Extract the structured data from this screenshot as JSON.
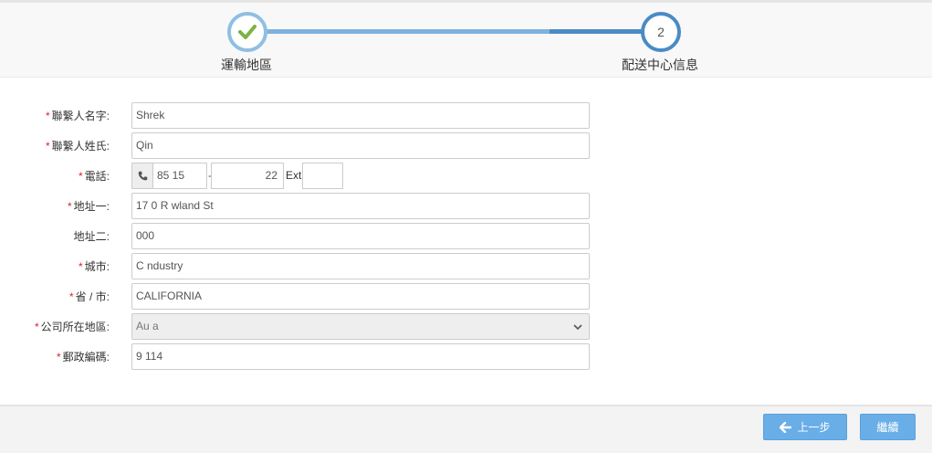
{
  "stepper": {
    "steps": [
      {
        "label": "運輸地區",
        "state": "done"
      },
      {
        "label": "配送中心信息",
        "number": "2",
        "state": "current"
      }
    ]
  },
  "form": {
    "first_name": {
      "label": "聯繫人名字:",
      "value": "Shrek",
      "required": true
    },
    "last_name": {
      "label": "聯繫人姓氏:",
      "value": "Qin",
      "required": true
    },
    "phone": {
      "label": "電話:",
      "area": "85  15",
      "number": "22",
      "ext_label": "Ext",
      "ext": "",
      "required": true
    },
    "address1": {
      "label": "地址一:",
      "value": "17  0 R wland St",
      "required": true
    },
    "address2": {
      "label": "地址二:",
      "value": "000",
      "required": false
    },
    "city": {
      "label": "城市:",
      "value": "C   ndustry",
      "required": true
    },
    "state": {
      "label": "省 / 市:",
      "value": "CALIFORNIA",
      "required": true
    },
    "country": {
      "label": "公司所在地區:",
      "value": "Au   a",
      "required": true
    },
    "postal": {
      "label": "郵政編碼:",
      "value": "9    114",
      "required": true
    }
  },
  "footer": {
    "prev_label": "上一步",
    "next_label": "繼續"
  },
  "colors": {
    "accent": "#4a8bc4",
    "button": "#6aaee8",
    "required": "#d9232d",
    "check": "#7cb342"
  }
}
